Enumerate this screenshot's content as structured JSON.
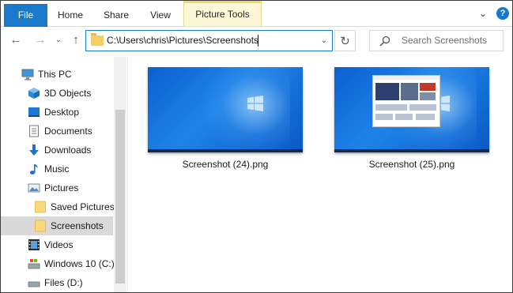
{
  "ribbon": {
    "tabs": [
      "File",
      "Home",
      "Share",
      "View"
    ],
    "context_tab": "Picture Tools",
    "help": "?",
    "accent": "#1979ca",
    "context_color": "#fdf6d7"
  },
  "navbar": {
    "address": "C:\\Users\\chris\\Pictures\\Screenshots",
    "search_placeholder": "Search Screenshots"
  },
  "sidebar": {
    "items": [
      {
        "label": "This PC",
        "icon": "monitor-icon"
      },
      {
        "label": "3D Objects",
        "icon": "cube-icon"
      },
      {
        "label": "Desktop",
        "icon": "desktop-icon"
      },
      {
        "label": "Documents",
        "icon": "document-icon"
      },
      {
        "label": "Downloads",
        "icon": "download-arrow-icon"
      },
      {
        "label": "Music",
        "icon": "music-note-icon"
      },
      {
        "label": "Pictures",
        "icon": "pictures-icon"
      },
      {
        "label": "Saved Pictures",
        "icon": "folder-icon"
      },
      {
        "label": "Screenshots",
        "icon": "folder-icon",
        "selected": true
      },
      {
        "label": "Videos",
        "icon": "film-icon"
      },
      {
        "label": "Windows 10 (C:)",
        "icon": "drive-icon"
      },
      {
        "label": "Files (D:)",
        "icon": "drive-icon"
      }
    ]
  },
  "files": [
    {
      "name": "Screenshot (24).png",
      "thumbnail": "windows-desktop-wallpaper"
    },
    {
      "name": "Screenshot (25).png",
      "thumbnail": "windows-desktop-with-browser-window"
    }
  ]
}
